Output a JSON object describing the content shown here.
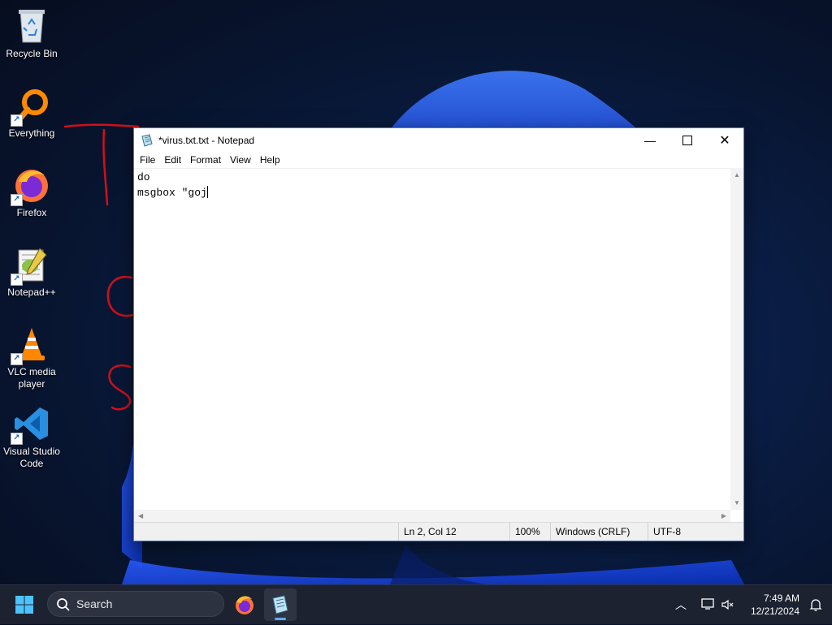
{
  "desktop": {
    "icons": [
      {
        "label": "Recycle Bin",
        "icon": "recycle-bin-icon"
      },
      {
        "label": "Everything",
        "icon": "everything-search-icon"
      },
      {
        "label": "Firefox",
        "icon": "firefox-icon"
      },
      {
        "label": "Notepad++",
        "icon": "notepad-plus-plus-icon"
      },
      {
        "label": "VLC media player",
        "icon": "vlc-icon"
      },
      {
        "label": "Visual Studio Code",
        "icon": "vscode-icon"
      }
    ]
  },
  "notepad": {
    "title": "*virus.txt.txt - Notepad",
    "menu": [
      "File",
      "Edit",
      "Format",
      "View",
      "Help"
    ],
    "lines": [
      "do",
      "msgbox \"goj"
    ],
    "status": {
      "position": "Ln 2, Col 12",
      "zoom": "100%",
      "line_ending": "Windows (CRLF)",
      "encoding": "UTF-8"
    }
  },
  "taskbar": {
    "search_label": "Search",
    "time": "7:49 AM",
    "date": "12/21/2024"
  },
  "colors": {
    "accent": "#5ea8ff",
    "annotation": "#d0101a",
    "taskbar": "#1c2230"
  }
}
